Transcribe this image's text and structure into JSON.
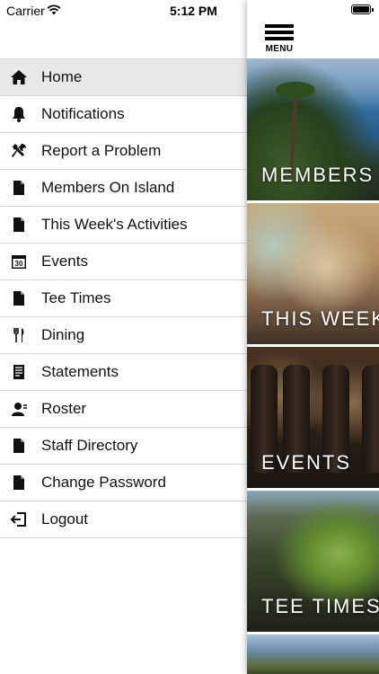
{
  "status_bar": {
    "carrier": "Carrier",
    "time": "5:12 PM"
  },
  "menu_button": {
    "label": "MENU"
  },
  "menu": {
    "items": [
      {
        "label": "Home",
        "icon": "home-icon",
        "active": true
      },
      {
        "label": "Notifications",
        "icon": "bell-icon"
      },
      {
        "label": "Report a Problem",
        "icon": "tools-icon"
      },
      {
        "label": "Members On Island",
        "icon": "document-icon"
      },
      {
        "label": "This Week's Activities",
        "icon": "document-icon"
      },
      {
        "label": "Events",
        "icon": "calendar-icon"
      },
      {
        "label": "Tee Times",
        "icon": "document-icon"
      },
      {
        "label": "Dining",
        "icon": "fork-knife-icon"
      },
      {
        "label": "Statements",
        "icon": "statement-icon"
      },
      {
        "label": "Roster",
        "icon": "roster-icon"
      },
      {
        "label": "Staff Directory",
        "icon": "document-icon"
      },
      {
        "label": "Change Password",
        "icon": "document-icon"
      },
      {
        "label": "Logout",
        "icon": "logout-icon"
      }
    ],
    "calendar_day": "30"
  },
  "tiles": [
    {
      "title": "MEMBERS"
    },
    {
      "title": "THIS WEEK"
    },
    {
      "title": "EVENTS"
    },
    {
      "title": "TEE TIMES"
    },
    {
      "title": ""
    }
  ]
}
